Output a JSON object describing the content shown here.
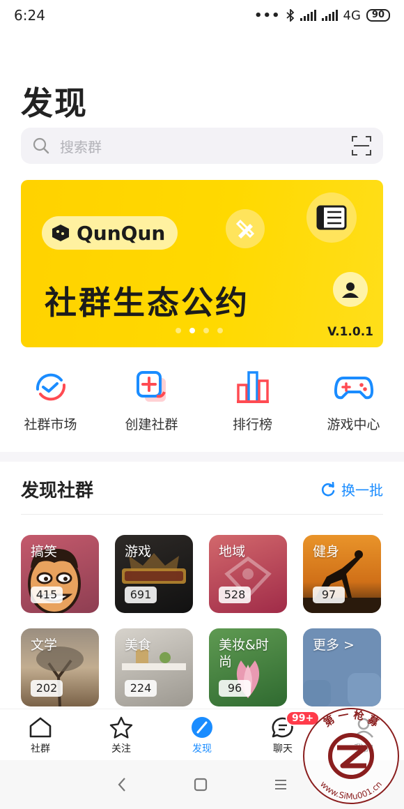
{
  "status": {
    "time": "6:24",
    "network": "4G",
    "battery": "90"
  },
  "page": {
    "title": "发现"
  },
  "search": {
    "placeholder": "搜索群"
  },
  "banner": {
    "logo_text": "QunQun",
    "headline": "社群生态公约",
    "version": "V.1.0.1",
    "slide_count": 4,
    "active_slide": 2,
    "bg_color": "#ffd400"
  },
  "quick_actions": [
    {
      "label": "社群市场",
      "icon": "market-icon"
    },
    {
      "label": "创建社群",
      "icon": "create-group-icon"
    },
    {
      "label": "排行榜",
      "icon": "ranking-icon"
    },
    {
      "label": "游戏中心",
      "icon": "gamepad-icon"
    }
  ],
  "discover": {
    "title": "发现社群",
    "refresh_label": "换一批",
    "categories": [
      {
        "name": "搞笑",
        "count": "415"
      },
      {
        "name": "游戏",
        "count": "691"
      },
      {
        "name": "地域",
        "count": "528"
      },
      {
        "name": "健身",
        "count": "97"
      },
      {
        "name": "文学",
        "count": "202"
      },
      {
        "name": "美食",
        "count": "224"
      },
      {
        "name": "美妆&时尚",
        "count": "96"
      },
      {
        "name": "更多 >"
      }
    ]
  },
  "tabs": [
    {
      "label": "社群",
      "icon": "home-icon"
    },
    {
      "label": "关注",
      "icon": "star-icon"
    },
    {
      "label": "发现",
      "icon": "compass-icon",
      "active": true
    },
    {
      "label": "聊天",
      "icon": "chat-icon",
      "badge": "99+"
    },
    {
      "label": "我的",
      "icon": "profile-icon"
    }
  ],
  "watermark": {
    "text": "第 一 枪 募",
    "url": "www.SiMu001.cn"
  },
  "colors": {
    "accent": "#1a8cff",
    "badge": "#ff3b4a",
    "banner": "#ffd400"
  }
}
